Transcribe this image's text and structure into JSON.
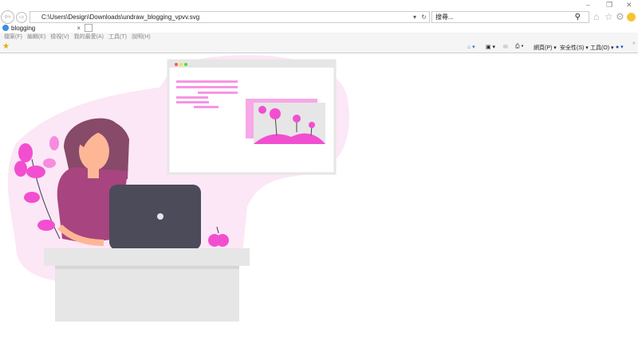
{
  "window": {
    "minimize": "–",
    "maximize": "❐",
    "close": "✕"
  },
  "nav": {
    "back": "⇦",
    "forward": "⇨",
    "address": "C:\\Users\\Design\\Downloads\\undraw_blogging_vpvv.svg",
    "refresh": "↻",
    "search_placeholder": "搜尋...",
    "search_icon": "⚲"
  },
  "tab": {
    "label": "blogging",
    "close": "×"
  },
  "menu": [
    "檔案(F)",
    "編輯(E)",
    "檢視(V)",
    "我的最愛(A)",
    "工具(T)",
    "說明(H)"
  ],
  "commands": {
    "page": "網頁(P) ▾",
    "safety": "安全性(S) ▾",
    "tools": "工具(O) ▾",
    "more": "»"
  },
  "colors": {
    "accent": "#f14fd0",
    "pink_light": "#fce7f6",
    "dark": "#4c4b5a"
  }
}
